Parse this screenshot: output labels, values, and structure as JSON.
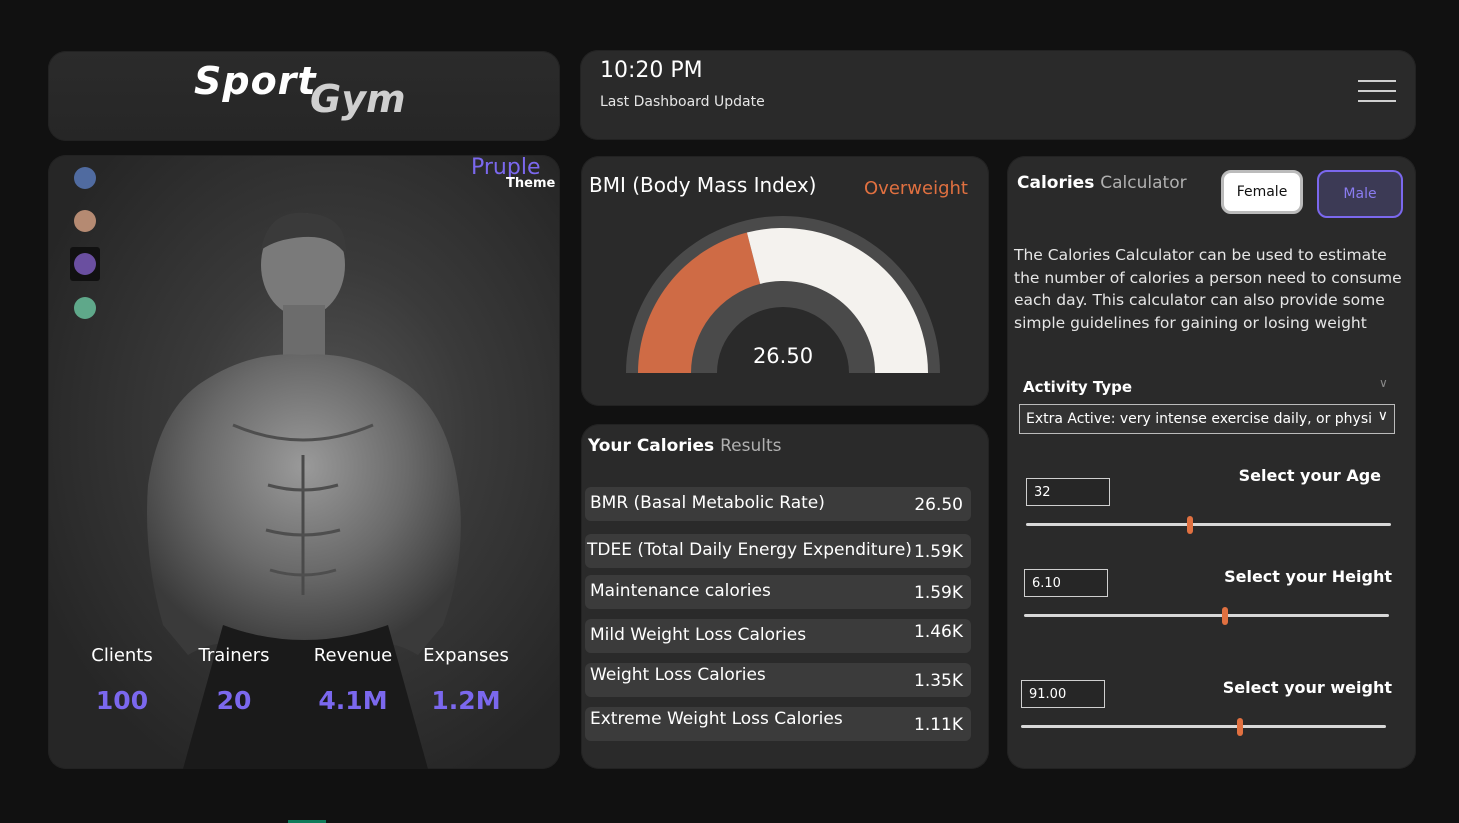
{
  "logo": {
    "word1": "Sport",
    "word2": "Gym"
  },
  "header": {
    "time": "10:20 PM",
    "update_label": "Last Dashboard Update"
  },
  "theme": {
    "name": "Pruple",
    "label": "Theme",
    "swatches": [
      "#506ba0",
      "#b58a72",
      "#6a4fa0",
      "#5fa88a"
    ],
    "selected_index": 2
  },
  "stats": [
    {
      "label": "Clients",
      "value": "100"
    },
    {
      "label": "Trainers",
      "value": "20"
    },
    {
      "label": "Revenue",
      "value": "4.1M"
    },
    {
      "label": "Expanses",
      "value": "1.2M"
    }
  ],
  "bmi": {
    "title": "BMI (Body Mass Index)",
    "status": "Overweight",
    "value": "26.50",
    "gauge_fraction": 0.42,
    "colors": {
      "fill": "#cf6b45",
      "remaining": "#f4f2ee",
      "base": "#4a4a4a"
    }
  },
  "results": {
    "title_main": "Your Calories",
    "title_muted": "Results",
    "rows": [
      {
        "label": "BMR (Basal Metabolic Rate)",
        "value": "26.50"
      },
      {
        "label": "TDEE (Total Daily Energy Expenditure)",
        "value": "1.59K"
      },
      {
        "label": "Maintenance calories",
        "value": "1.59K"
      },
      {
        "label": "Mild Weight Loss Calories",
        "value": "1.46K"
      },
      {
        "label": "Weight Loss Calories",
        "value": "1.35K"
      },
      {
        "label": "Extreme Weight Loss Calories",
        "value": "1.11K"
      }
    ]
  },
  "calculator": {
    "title_main": "Calories",
    "title_muted": "Calculator",
    "female_label": "Female",
    "male_label": "Male",
    "description": "The Calories Calculator can be used to estimate the number of calories a person need to consume each day. This calculator can also provide some simple guidelines for gaining or losing weight",
    "activity_label": "Activity Type",
    "activity_value": "Extra Active: very intense exercise daily, or physica...",
    "age": {
      "label": "Select your Age",
      "value": "32",
      "fraction": 0.45
    },
    "height": {
      "label": "Select your Height",
      "value": "6.10",
      "fraction": 0.55
    },
    "weight": {
      "label": "Select your weight",
      "value": "91.00",
      "fraction": 0.6
    },
    "accent": "#e07040"
  }
}
